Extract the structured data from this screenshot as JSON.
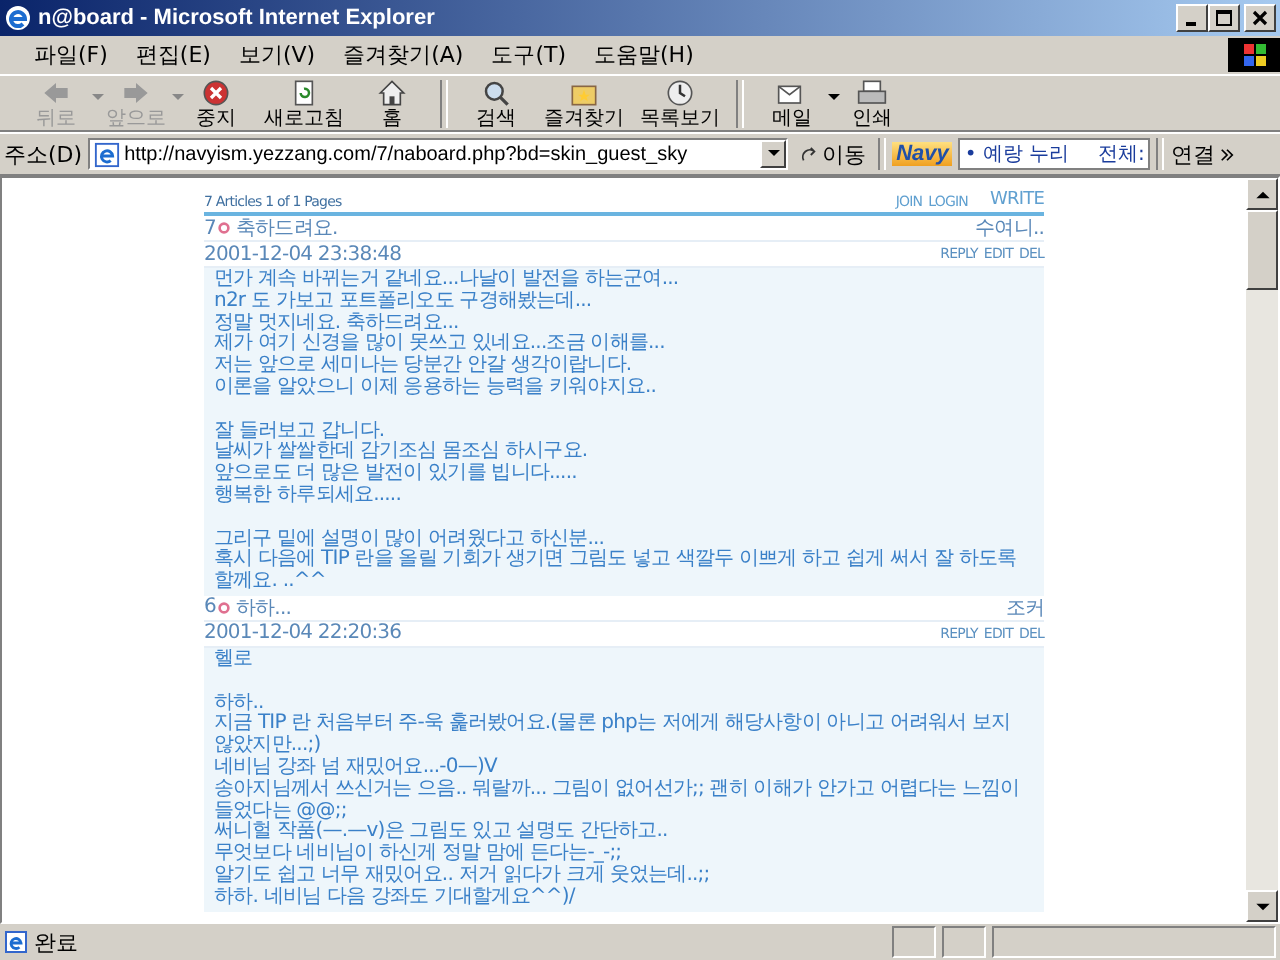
{
  "window": {
    "title": "n@board - Microsoft Internet Explorer"
  },
  "menu": [
    "파일(F)",
    "편집(E)",
    "보기(V)",
    "즐겨찾기(A)",
    "도구(T)",
    "도움말(H)"
  ],
  "toolbar": [
    {
      "kind": "back",
      "label": "뒤로",
      "disabled": true,
      "dropdown": true
    },
    {
      "kind": "forward",
      "label": "앞으로",
      "disabled": true,
      "dropdown": true
    },
    {
      "kind": "stop",
      "label": "중지",
      "disabled": false,
      "dropdown": false
    },
    {
      "kind": "refresh",
      "label": "새로고침",
      "disabled": false,
      "dropdown": false
    },
    {
      "kind": "home",
      "label": "홈",
      "disabled": false,
      "dropdown": false
    },
    {
      "kind": "search",
      "label": "검색",
      "disabled": false,
      "dropdown": false
    },
    {
      "kind": "favorites",
      "label": "즐겨찾기",
      "disabled": false,
      "dropdown": false
    },
    {
      "kind": "history",
      "label": "목록보기",
      "disabled": false,
      "dropdown": false
    },
    {
      "kind": "mail",
      "label": "메일",
      "disabled": false,
      "dropdown": true
    },
    {
      "kind": "print",
      "label": "인쇄",
      "disabled": false,
      "dropdown": false
    }
  ],
  "address": {
    "label": "주소(D)",
    "url": "http://navyism.yezzang.com/7/naboard.php?bd=skin_guest_sky",
    "go": "이동"
  },
  "navy": {
    "logo": "Navy",
    "value": "• 예랑 누리",
    "scope": "전체:"
  },
  "links_label": "연결",
  "board": {
    "summary": "7 Articles 1 of 1 Pages",
    "member_links": [
      "JOIN",
      "LOGIN"
    ],
    "write": "WRITE",
    "posts": [
      {
        "number": "7",
        "title": "축하드려요.",
        "author": "수여니..",
        "date": "2001-12-04 23:38:48",
        "actions": [
          "REPLY",
          "EDIT",
          "DEL"
        ],
        "body": [
          [
            "먼가 계속 바뀌는거 같네요...나날이 발전을 하는군여...",
            "n2r 도 가보고 포트폴리오도 구경해봤는데...",
            "정말 멋지네요. 축하드려요...",
            "제가 여기 신경을 많이 못쓰고 있네요...조금 이해를...",
            "저는 앞으로 세미나는 당분간 안갈 생각이랍니다.",
            "이론을 알았으니 이제 응용하는 능력을 키워야지요.."
          ],
          [
            "잘 들러보고 갑니다.",
            "날씨가 쌀쌀한데 감기조심 몸조심 하시구요.",
            "앞으로도 더 많은 발전이 있기를 빕니다.....",
            "행복한 하루되세요....."
          ],
          [
            "그리구 밑에 설명이 많이 어려웠다고 하신분...",
            "혹시 다음에 TIP 란을 올릴 기회가 생기면 그림도 넣고 색깔두 이쁘게 하고 쉽게 써서 잘 하도록 할께요. ..^^"
          ]
        ]
      },
      {
        "number": "6",
        "title": "하하...",
        "author": "조커",
        "date": "2001-12-04 22:20:36",
        "actions": [
          "REPLY",
          "EDIT",
          "DEL"
        ],
        "body": [
          [
            "헬로"
          ],
          [
            "하하..",
            "지금 TIP 란 처음부터 주-욱 훑러봤어요.(물론 php는 저에게 해당사항이 아니고 어려워서 보지 않았지만...;)",
            "네비님 강좌 넘 재밌어요...-0—)V",
            "송아지님께서 쓰신거는 으음.. 뭐랄까... 그림이 없어선가;; 괜히 이해가 안가고 어렵다는 느낌이 들었다는 @@;;",
            "써니헐 작품(—.—v)은 그림도 있고 설명도 간단하고..",
            "무엇보다 네비님이 하신게 정말 맘에 든다는-_-;;",
            "알기도 쉽고 너무 재밌어요.. 저거 읽다가 크게 웃었는데..;;",
            "하하. 네비님 다음 강좌도 기대할게요^^)/"
          ]
        ]
      }
    ]
  },
  "status": {
    "text": "완료"
  }
}
